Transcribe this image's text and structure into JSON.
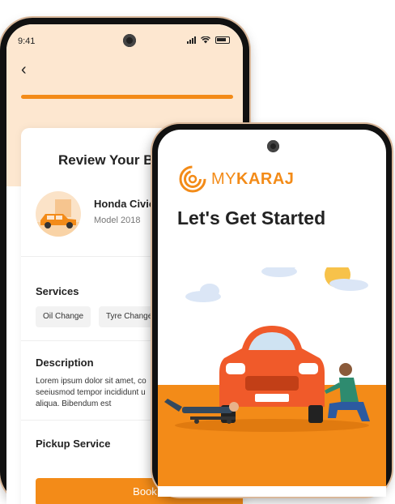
{
  "back_screen": {
    "status_time": "9:41",
    "title": "Review Your Bo",
    "car": {
      "name": "Honda Civic",
      "model": "Model 2018"
    },
    "services_title": "Services",
    "services": [
      "Oil Change",
      "Tyre Change"
    ],
    "description_title": "Description",
    "description_lines": [
      "Lorem ipsum dolor sit amet, co",
      "seeiusmod tempor incididunt u",
      "aliqua. Bibendum est"
    ],
    "pickup_title": "Pickup Service",
    "book_label": "Book"
  },
  "front_screen": {
    "logo": {
      "prefix": "MY",
      "suffix": "KARAJ"
    },
    "headline": "Let's Get Started"
  },
  "colors": {
    "accent": "#f38b18",
    "header_bg": "#fde7d0"
  }
}
